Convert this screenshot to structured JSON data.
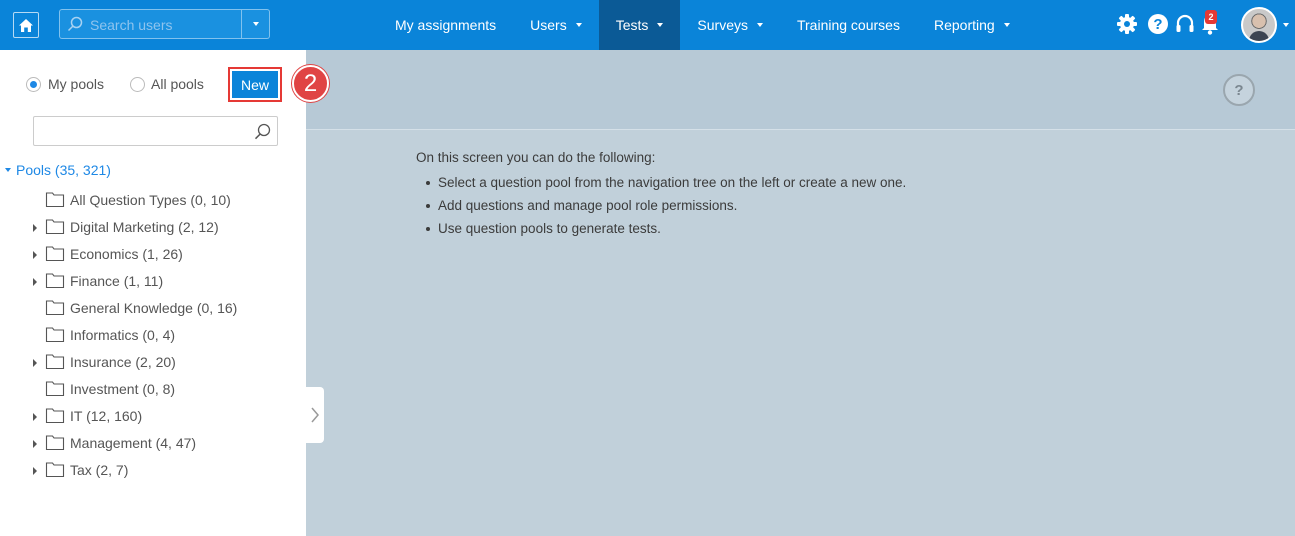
{
  "topbar": {
    "search_placeholder": "Search users",
    "nav": [
      {
        "label": "My assignments",
        "dropdown": false,
        "active": false
      },
      {
        "label": "Users",
        "dropdown": true,
        "active": false
      },
      {
        "label": "Tests",
        "dropdown": true,
        "active": true
      },
      {
        "label": "Surveys",
        "dropdown": true,
        "active": false
      },
      {
        "label": "Training courses",
        "dropdown": false,
        "active": false
      },
      {
        "label": "Reporting",
        "dropdown": true,
        "active": false
      }
    ],
    "notification_count": "2",
    "help_glyph": "?"
  },
  "sidebar": {
    "radio_my_pools": "My pools",
    "radio_all_pools": "All pools",
    "selected_radio": "My pools",
    "new_button": "New",
    "step_number": "2",
    "tree_search_value": "",
    "tree_root": "Pools (35, 321)",
    "items": [
      {
        "label": "All Question Types (0, 10)",
        "expandable": false
      },
      {
        "label": "Digital Marketing (2, 12)",
        "expandable": true
      },
      {
        "label": "Economics (1, 26)",
        "expandable": true
      },
      {
        "label": "Finance (1, 11)",
        "expandable": true
      },
      {
        "label": "General Knowledge (0, 16)",
        "expandable": false
      },
      {
        "label": "Informatics (0, 4)",
        "expandable": false
      },
      {
        "label": "Insurance (2, 20)",
        "expandable": true
      },
      {
        "label": "Investment (0, 8)",
        "expandable": false
      },
      {
        "label": "IT (12, 160)",
        "expandable": true
      },
      {
        "label": "Management (4, 47)",
        "expandable": true
      },
      {
        "label": "Tax (2, 7)",
        "expandable": true
      }
    ]
  },
  "main": {
    "help_glyph": "?",
    "intro": "On this screen you can do the following:",
    "bullets": [
      "Select a question pool from the navigation tree on the left or create a new one.",
      "Add questions and manage pool role permissions.",
      "Use question pools to generate tests."
    ]
  },
  "colors": {
    "topbar": "#0a84d9",
    "active_nav": "#0b5a96",
    "main_bg": "#c1d0da",
    "highlight": "#e53935"
  }
}
